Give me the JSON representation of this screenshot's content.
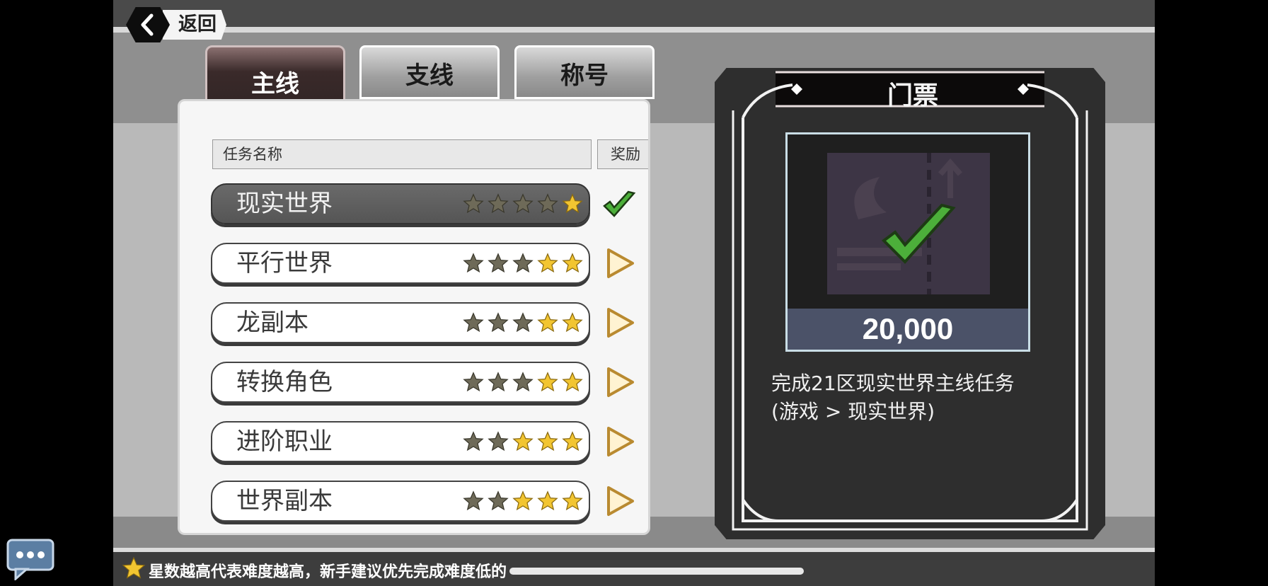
{
  "back": {
    "label": "返回"
  },
  "tabs": [
    {
      "label": "主线",
      "active": true
    },
    {
      "label": "支线",
      "active": false
    },
    {
      "label": "称号",
      "active": false
    }
  ],
  "table": {
    "col_name": "任务名称",
    "col_reward": "奖励"
  },
  "quests": [
    {
      "name": "现实世界",
      "stars_dark": 4,
      "stars_gold": 1,
      "status": "completed"
    },
    {
      "name": "平行世界",
      "stars_dark": 3,
      "stars_gold": 2,
      "status": "go"
    },
    {
      "name": "龙副本",
      "stars_dark": 3,
      "stars_gold": 2,
      "status": "go"
    },
    {
      "name": "转换角色",
      "stars_dark": 3,
      "stars_gold": 2,
      "status": "go"
    },
    {
      "name": "进阶职业",
      "stars_dark": 2,
      "stars_gold": 3,
      "status": "go"
    },
    {
      "name": "世界副本",
      "stars_dark": 2,
      "stars_gold": 3,
      "status": "go"
    }
  ],
  "reward": {
    "title": "门票",
    "amount": "20,000",
    "description_line1": "完成21区现实世界主线任务",
    "description_line2": "(游戏 > 现实世界)"
  },
  "footer": {
    "tip": "星数越高代表难度越高，新手建议优先完成难度低的"
  },
  "colors": {
    "accent_gold": "#f2c531",
    "dark_star": "#6e6a58",
    "check_green": "#4caf3a"
  }
}
